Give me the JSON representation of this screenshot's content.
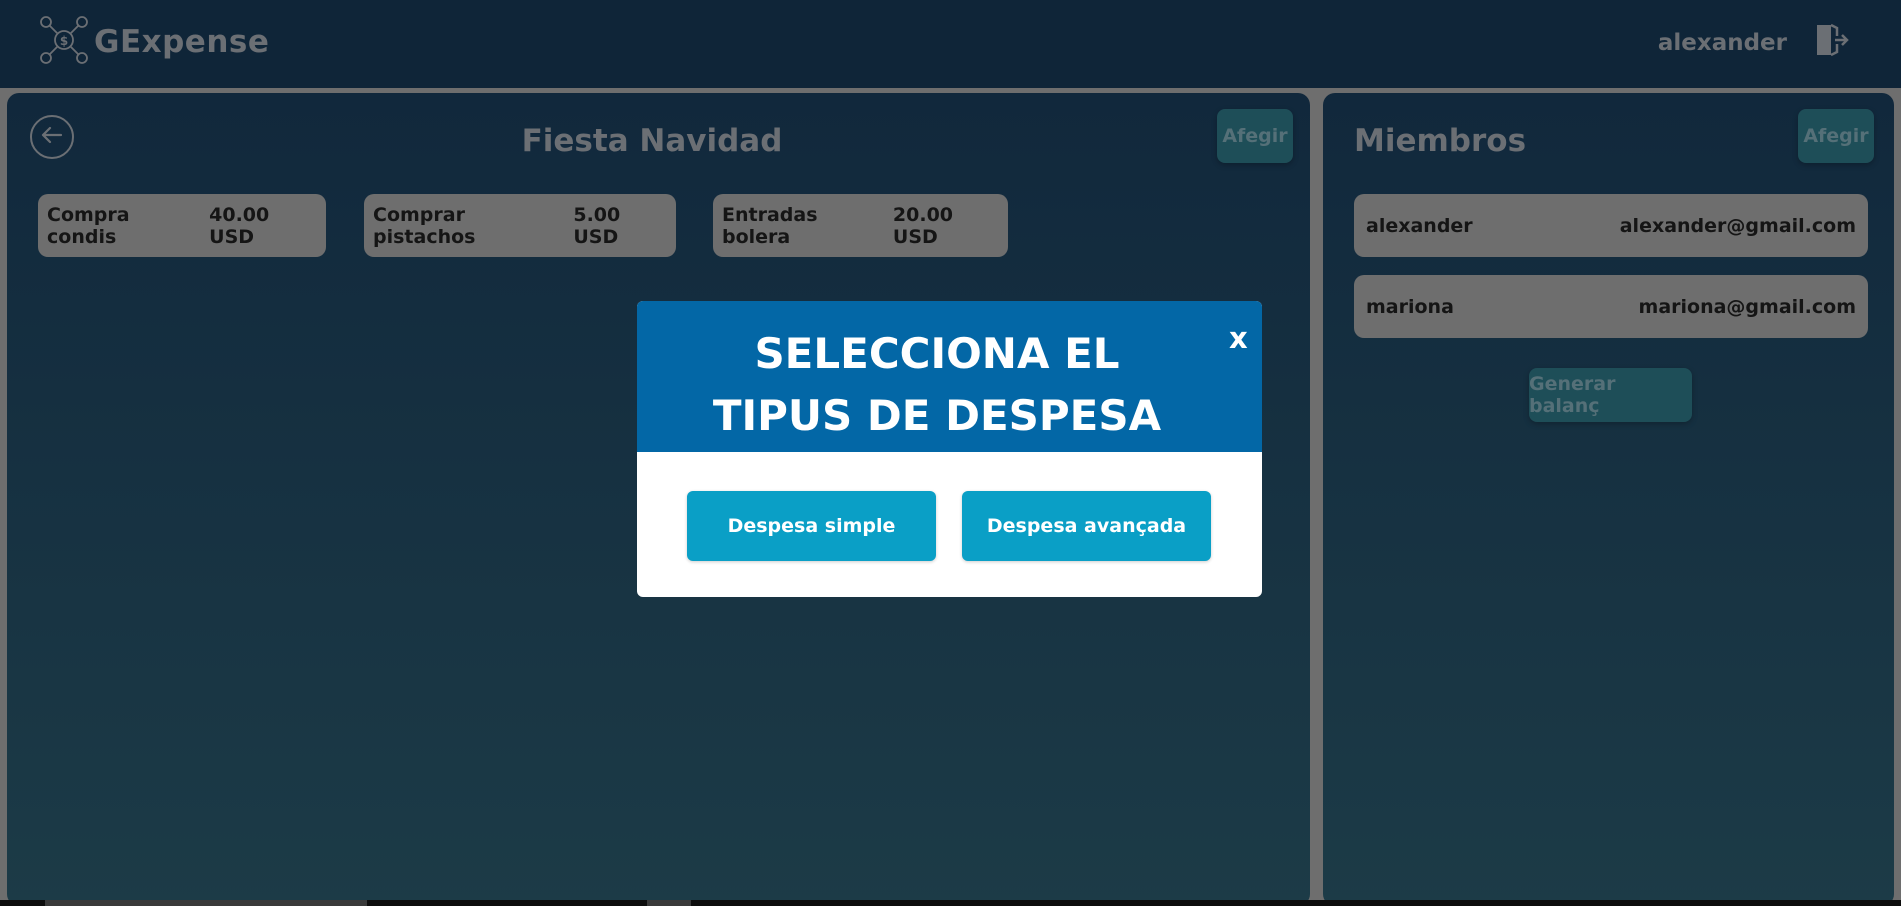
{
  "header": {
    "app_name": "GExpense",
    "username": "alexander",
    "logo_icon": "network-dollar-icon",
    "logout_icon": "logout-door-icon"
  },
  "group": {
    "title": "Fiesta Navidad",
    "add_label": "Afegir",
    "expenses": [
      {
        "name": "Compra condis",
        "amount": "40.00 USD"
      },
      {
        "name": "Comprar pistachos",
        "amount": "5.00 USD"
      },
      {
        "name": "Entradas bolera",
        "amount": "20.00 USD"
      }
    ]
  },
  "members": {
    "title": "Miembros",
    "add_label": "Afegir",
    "list": [
      {
        "name": "alexander",
        "email": "alexander@gmail.com"
      },
      {
        "name": "mariona",
        "email": "mariona@gmail.com"
      }
    ],
    "balance_label": "Generar balanç"
  },
  "modal": {
    "title": "SELECCIONA EL TIPUS DE DESPESA",
    "close_label": "x",
    "options": [
      "Despesa simple",
      "Despesa avançada"
    ]
  },
  "colors": {
    "header_bg": "#0f2538",
    "modal_header": "#0367a6",
    "modal_button": "#0a9fc6",
    "card_bg": "#6e6e6e"
  }
}
